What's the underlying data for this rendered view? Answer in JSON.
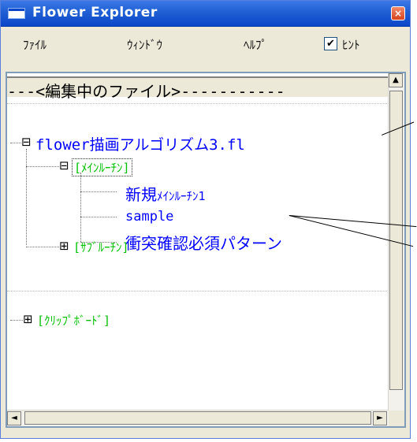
{
  "window": {
    "title": "Flower Explorer",
    "close_glyph": "×"
  },
  "menu": {
    "file": "ﾌｧｲﾙ",
    "window": "ｳｨﾝﾄﾞｳ",
    "help": "ﾍﾙﾌﾟ",
    "hint_checkbox_mark": "✔",
    "hint_label": "ﾋﾝﾄ"
  },
  "tree": {
    "header": "---<編集中のファイル>-----------",
    "file_node": "flower描画アルゴリズム3.fl",
    "main_routine": "[ﾒｲﾝﾙｰﾁﾝ]",
    "main_children": [
      {
        "prefix": "新規",
        "suffix": "ﾒｲﾝﾙｰﾁﾝ1"
      },
      {
        "prefix": "sample",
        "suffix": ""
      },
      {
        "prefix": "衝突確認必須パターン",
        "suffix": ""
      }
    ],
    "sub_routine": "[ｻﾌﾞﾙｰﾁﾝ]",
    "clipboard": "[ｸﾘｯﾌﾟﾎﾞｰﾄﾞ]",
    "expander_minus": "⊟",
    "expander_plus": "⊞"
  },
  "scrollbars": {
    "up_arrow": "▲",
    "down_arrow": "▼",
    "left_arrow": "◄",
    "right_arrow": "►"
  },
  "colors": {
    "titlebar": "#0a46c9",
    "node_blue": "#0000ff",
    "node_green": "#00c000"
  }
}
